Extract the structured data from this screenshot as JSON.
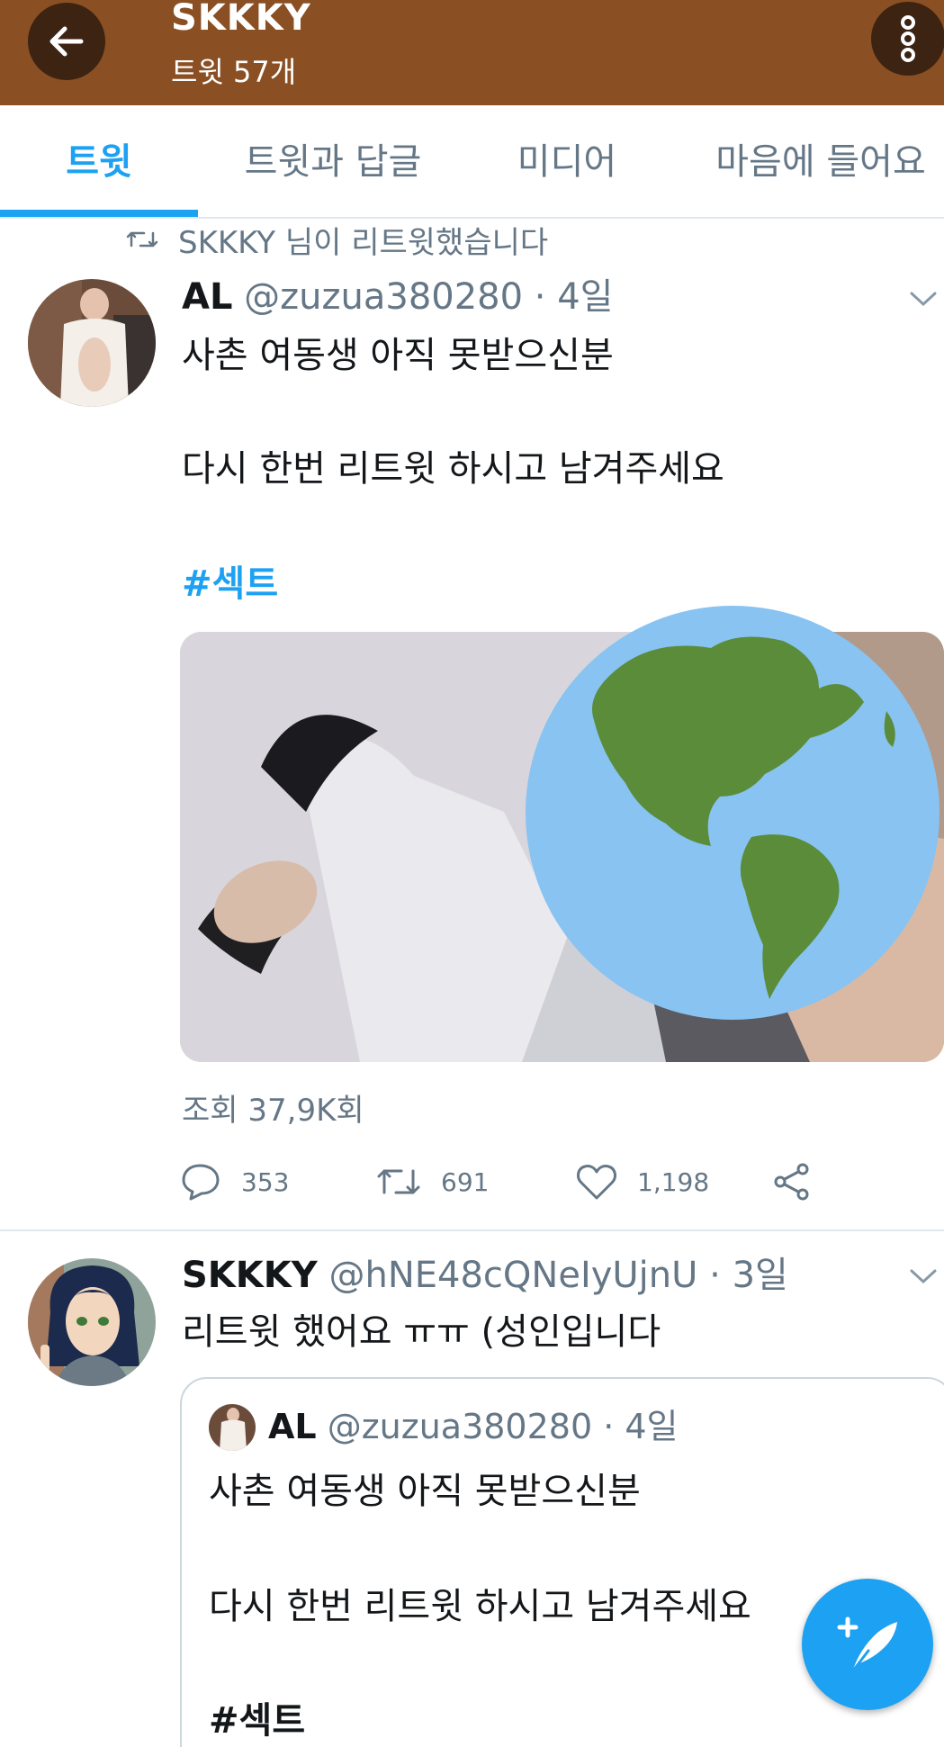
{
  "header": {
    "title": "SKKKY",
    "subtitle": "트윗 57개"
  },
  "tabs": [
    {
      "label": "트윗",
      "active": true
    },
    {
      "label": "트윗과 답글",
      "active": false
    },
    {
      "label": "미디어",
      "active": false
    },
    {
      "label": "마음에 들어요",
      "active": false
    }
  ],
  "retweet_context": "SKKKY 님이 리트윗했습니다",
  "tweets": [
    {
      "name": "AL",
      "handle": "@zuzua380280 · 4일",
      "lines": [
        "사촌 여동생 아직 못받으신분",
        "다시 한번 리트윗 하시고 남겨주세요"
      ],
      "hashtag": "#섹트",
      "views": "조회 37,9K회",
      "replies": "353",
      "retweets": "691",
      "likes": "1,198"
    },
    {
      "name": "SKKKY",
      "handle": "@hNE48cQNeIyUjnU · 3일",
      "text": "리트윗 했어요 ㅠㅠ (성인입니다"
    }
  ],
  "quoted": {
    "name": "AL",
    "handle": "@zuzua380280 · 4일",
    "lines": [
      "사촌 여동생 아직 못받으신분",
      "다시 한번 리트윗 하시고 남겨주세요"
    ],
    "hashtag": "#섹트"
  },
  "colors": {
    "header_bg": "#8a4f23",
    "accent": "#1da1f2",
    "muted": "#657786"
  },
  "icons": [
    "arrow-left-icon",
    "more-vertical-icon",
    "retweet-icon",
    "chevron-down-icon",
    "reply-icon",
    "like-icon",
    "share-icon",
    "globe-icon",
    "compose-icon"
  ]
}
